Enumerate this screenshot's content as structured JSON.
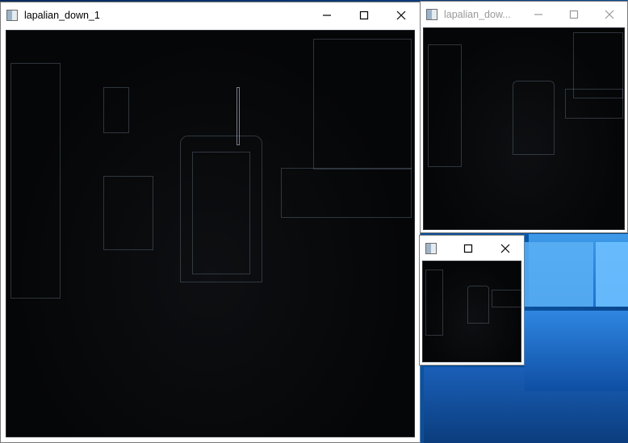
{
  "windows": [
    {
      "title": "lapalian_down_1",
      "active": true
    },
    {
      "title": "lapalian_dow...",
      "active": false
    },
    {
      "title": "",
      "active": false
    }
  ],
  "icons": {
    "app": "window-app-icon",
    "minimize": "minimize-icon",
    "maximize": "maximize-icon",
    "close": "close-icon"
  }
}
